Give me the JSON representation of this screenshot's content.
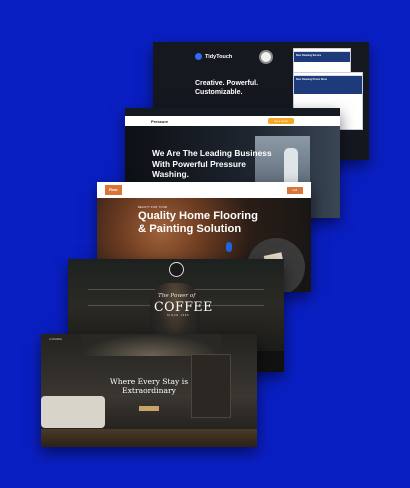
{
  "background_color": "#0a1fc2",
  "cards": {
    "tidytouch": {
      "logo": "TidyTouch",
      "headline": "Creative. Powerful. Customizable.",
      "mini_headline": "Best Cleaning Service",
      "mini_headline_2": "Best Cleaning Promo Store"
    },
    "pressure": {
      "logo": "Pressure",
      "headline": "We Are The Leading Business With Powerful Pressure Washing.",
      "cta": "Get a Quote"
    },
    "floor": {
      "logo": "Floor",
      "tagline": "BEAUTY FOR YOUR",
      "headline": "Quality Home Flooring & Painting Solution",
      "cta": "Call"
    },
    "coffee": {
      "script": "The Power of",
      "headline": "COFFEE",
      "since": "SINCE 1996"
    },
    "hotel": {
      "logo": "LUXURIA",
      "headline": "Where Every Stay is Extraordinary"
    }
  }
}
